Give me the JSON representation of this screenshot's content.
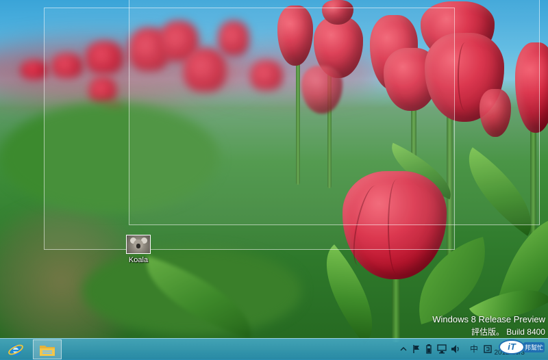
{
  "desktop": {
    "icons": [
      {
        "label": "Koala",
        "icon": "koala-image-icon"
      }
    ],
    "watermark": {
      "line1": "Windows 8 Release Preview",
      "line2": "評估版。 Build 8400"
    }
  },
  "taskbar": {
    "pinned": [
      {
        "name": "internet-explorer",
        "icon": "ie-icon",
        "active": false
      },
      {
        "name": "file-explorer",
        "icon": "folder-icon",
        "active": true
      }
    ],
    "tray": {
      "ime": "中",
      "icons": [
        "up-arrow-icon",
        "flag-icon",
        "power-icon",
        "network-icon",
        "volume-icon",
        "keyboard-icon"
      ]
    },
    "clock": "2012/10/3"
  },
  "brand_logo": {
    "text": "iT",
    "tag": "邦幫忙"
  },
  "colors": {
    "taskbar": "#2f8fb0",
    "ie_blue": "#1e88d8",
    "folder": "#f3c64a",
    "logo_blue": "#1f6fb3"
  }
}
